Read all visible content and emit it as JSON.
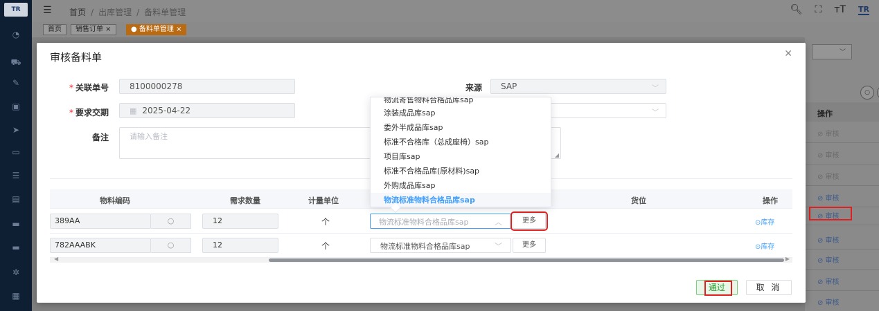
{
  "sidebar": {
    "logo": "TR",
    "icons": [
      "dashboard-icon",
      "cart-icon",
      "edit-icon",
      "box-icon",
      "send-icon",
      "monitor-icon",
      "list-icon",
      "package-icon",
      "card-icon",
      "card2-icon",
      "bug-icon",
      "grid-icon"
    ]
  },
  "header": {
    "breadcrumb": [
      "首页",
      "出库管理",
      "备料单管理"
    ],
    "brand": "TR"
  },
  "tabs": [
    {
      "label": "首页"
    },
    {
      "label": "销售订单 ×"
    },
    {
      "label": "● 备料单管理 ×"
    }
  ],
  "background_table": {
    "header": "操作",
    "rows": [
      {
        "label": "⊘ 审核",
        "state": "dim"
      },
      {
        "label": "⊘ 审核",
        "state": "dim"
      },
      {
        "label": "⊘ 审核",
        "state": "dim"
      },
      {
        "label": "⊘ 审核",
        "state": "link"
      },
      {
        "label": "⊘ 审核",
        "state": "highlight"
      },
      {
        "label": "⊘ 审核",
        "state": "link"
      },
      {
        "label": "⊘ 审核",
        "state": "link"
      },
      {
        "label": "⊘ 审核",
        "state": "link"
      },
      {
        "label": "⊘ 审核",
        "state": "link"
      }
    ]
  },
  "dialog": {
    "title": "审核备料单",
    "fields": {
      "related_no_label": "关联单号",
      "related_no": "8100000278",
      "source_label": "来源",
      "source": "SAP",
      "due_date_label": "要求交期",
      "due_date": "2025-04-22",
      "remark_label": "备注",
      "remark_placeholder": "请输入备注"
    },
    "table": {
      "columns": [
        "物料编码",
        "需求数量",
        "计量单位",
        "货位",
        "操作"
      ],
      "rows": [
        {
          "code": "389AA",
          "qty": "12",
          "unit": "个",
          "warehouse": "物流标准物料合格品库sap",
          "more": "更多",
          "action": "⊙库存"
        },
        {
          "code": "782AAABK",
          "qty": "12",
          "unit": "个",
          "warehouse": "物流标准物料合格品库sap",
          "more": "更多",
          "action": "⊙库存"
        }
      ]
    },
    "dropdown_options": [
      "物流寄售物料合格品库sap",
      "涂装成品库sap",
      "委外半成品库sap",
      "标准不合格库（总成座椅）sap",
      "项目库sap",
      "标准不合格品库(原材料)sap",
      "外购成品库sap",
      "物流标准物料合格品库sap"
    ],
    "selected_option": "物流标准物料合格品库sap",
    "buttons": {
      "approve": "通过",
      "cancel": "取 消"
    }
  }
}
